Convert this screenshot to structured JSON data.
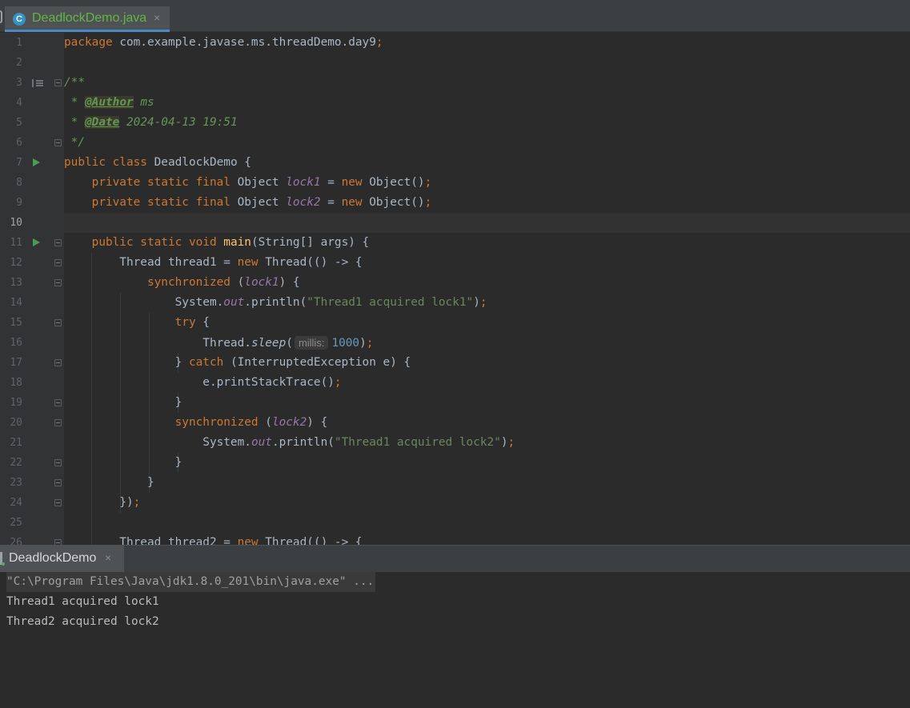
{
  "editor_tab": {
    "icon": "C",
    "filename": "DeadlockDemo.java",
    "close": "×"
  },
  "code_lines": [
    {
      "n": "1",
      "segments": [
        {
          "t": "package ",
          "c": "kw"
        },
        {
          "t": "com.example.javase.ms.threadDemo.day9",
          "c": ""
        },
        {
          "t": ";",
          "c": "kw"
        }
      ]
    },
    {
      "n": "2",
      "segments": []
    },
    {
      "n": "3",
      "segments": [
        {
          "t": "/**",
          "c": "doc"
        }
      ]
    },
    {
      "n": "4",
      "segments": [
        {
          "t": " * ",
          "c": "doc"
        },
        {
          "t": "@Author",
          "c": "tag"
        },
        {
          "t": " ms",
          "c": "doc"
        }
      ]
    },
    {
      "n": "5",
      "segments": [
        {
          "t": " * ",
          "c": "doc"
        },
        {
          "t": "@Date",
          "c": "tag"
        },
        {
          "t": " 2024-04-13 19:51",
          "c": "doc"
        }
      ]
    },
    {
      "n": "6",
      "segments": [
        {
          "t": " */",
          "c": "doc"
        }
      ]
    },
    {
      "n": "7",
      "segments": [
        {
          "t": "public class ",
          "c": "kw"
        },
        {
          "t": "DeadlockDemo {",
          "c": ""
        }
      ]
    },
    {
      "n": "8",
      "segments": [
        {
          "t": "    private static final ",
          "c": "kw"
        },
        {
          "t": "Object ",
          "c": ""
        },
        {
          "t": "lock1",
          "c": "field"
        },
        {
          "t": " = ",
          "c": ""
        },
        {
          "t": "new ",
          "c": "kw"
        },
        {
          "t": "Object()",
          "c": ""
        },
        {
          "t": ";",
          "c": "kw"
        }
      ]
    },
    {
      "n": "9",
      "segments": [
        {
          "t": "    private static final ",
          "c": "kw"
        },
        {
          "t": "Object ",
          "c": ""
        },
        {
          "t": "lock2",
          "c": "field"
        },
        {
          "t": " = ",
          "c": ""
        },
        {
          "t": "new ",
          "c": "kw"
        },
        {
          "t": "Object()",
          "c": ""
        },
        {
          "t": ";",
          "c": "kw"
        }
      ]
    },
    {
      "n": "10",
      "segments": []
    },
    {
      "n": "11",
      "segments": [
        {
          "t": "    public static void ",
          "c": "kw"
        },
        {
          "t": "main",
          "c": "fn"
        },
        {
          "t": "(String[] args) {",
          "c": ""
        }
      ]
    },
    {
      "n": "12",
      "segments": [
        {
          "t": "        Thread thread1 = ",
          "c": ""
        },
        {
          "t": "new ",
          "c": "kw"
        },
        {
          "t": "Thread(() -> {",
          "c": ""
        }
      ]
    },
    {
      "n": "13",
      "segments": [
        {
          "t": "            synchronized ",
          "c": "kw"
        },
        {
          "t": "(",
          "c": ""
        },
        {
          "t": "lock1",
          "c": "field"
        },
        {
          "t": ") {",
          "c": ""
        }
      ]
    },
    {
      "n": "14",
      "segments": [
        {
          "t": "                System.",
          "c": ""
        },
        {
          "t": "out",
          "c": "field"
        },
        {
          "t": ".println(",
          "c": ""
        },
        {
          "t": "\"Thread1 acquired lock1\"",
          "c": "str"
        },
        {
          "t": ")",
          "c": ""
        },
        {
          "t": ";",
          "c": "kw"
        }
      ]
    },
    {
      "n": "15",
      "segments": [
        {
          "t": "                try ",
          "c": "kw"
        },
        {
          "t": "{",
          "c": ""
        }
      ]
    },
    {
      "n": "16",
      "segments": [
        {
          "t": "                    Thread.",
          "c": ""
        },
        {
          "t": "sleep",
          "c": "italic"
        },
        {
          "t": "(",
          "c": ""
        },
        {
          "t": "millis:",
          "c": "hint"
        },
        {
          "t": "1000",
          "c": "num"
        },
        {
          "t": ")",
          "c": ""
        },
        {
          "t": ";",
          "c": "kw"
        }
      ]
    },
    {
      "n": "17",
      "segments": [
        {
          "t": "                } ",
          "c": ""
        },
        {
          "t": "catch ",
          "c": "kw"
        },
        {
          "t": "(InterruptedException e) {",
          "c": ""
        }
      ]
    },
    {
      "n": "18",
      "segments": [
        {
          "t": "                    e.printStackTrace()",
          "c": ""
        },
        {
          "t": ";",
          "c": "kw"
        }
      ]
    },
    {
      "n": "19",
      "segments": [
        {
          "t": "                }",
          "c": ""
        }
      ]
    },
    {
      "n": "20",
      "segments": [
        {
          "t": "                synchronized ",
          "c": "kw"
        },
        {
          "t": "(",
          "c": ""
        },
        {
          "t": "lock2",
          "c": "field"
        },
        {
          "t": ") {",
          "c": ""
        }
      ]
    },
    {
      "n": "21",
      "segments": [
        {
          "t": "                    System.",
          "c": ""
        },
        {
          "t": "out",
          "c": "field"
        },
        {
          "t": ".println(",
          "c": ""
        },
        {
          "t": "\"Thread1 acquired lock2\"",
          "c": "str"
        },
        {
          "t": ")",
          "c": ""
        },
        {
          "t": ";",
          "c": "kw"
        }
      ]
    },
    {
      "n": "22",
      "segments": [
        {
          "t": "                }",
          "c": ""
        }
      ]
    },
    {
      "n": "23",
      "segments": [
        {
          "t": "            }",
          "c": ""
        }
      ]
    },
    {
      "n": "24",
      "segments": [
        {
          "t": "        })",
          "c": ""
        },
        {
          "t": ";",
          "c": "kw"
        }
      ]
    },
    {
      "n": "25",
      "segments": []
    },
    {
      "n": "26",
      "segments": [
        {
          "t": "        Thread thread2 = ",
          "c": ""
        },
        {
          "t": "new ",
          "c": "kw"
        },
        {
          "t": "Thread(() -> {",
          "c": ""
        }
      ]
    }
  ],
  "current_line": "10",
  "run_lines": [
    "7",
    "11"
  ],
  "doc_lines": [
    "3"
  ],
  "fold_lines": [
    "3",
    "6",
    "11",
    "12",
    "13",
    "15",
    "17",
    "19",
    "20",
    "22",
    "23",
    "24",
    "26"
  ],
  "run_tab": {
    "label": "DeadlockDemo",
    "close": "×"
  },
  "console": {
    "command": "\"C:\\Program Files\\Java\\jdk1.8.0_201\\bin\\java.exe\" ...",
    "output": [
      "Thread1 acquired lock1",
      "Thread2 acquired lock2"
    ]
  },
  "colors": {
    "keyword": "#cc7832",
    "string": "#6a8759",
    "number": "#6897bb",
    "field": "#9876aa",
    "method": "#ffc66d",
    "doc": "#629755",
    "text": "#a9b7c6"
  }
}
